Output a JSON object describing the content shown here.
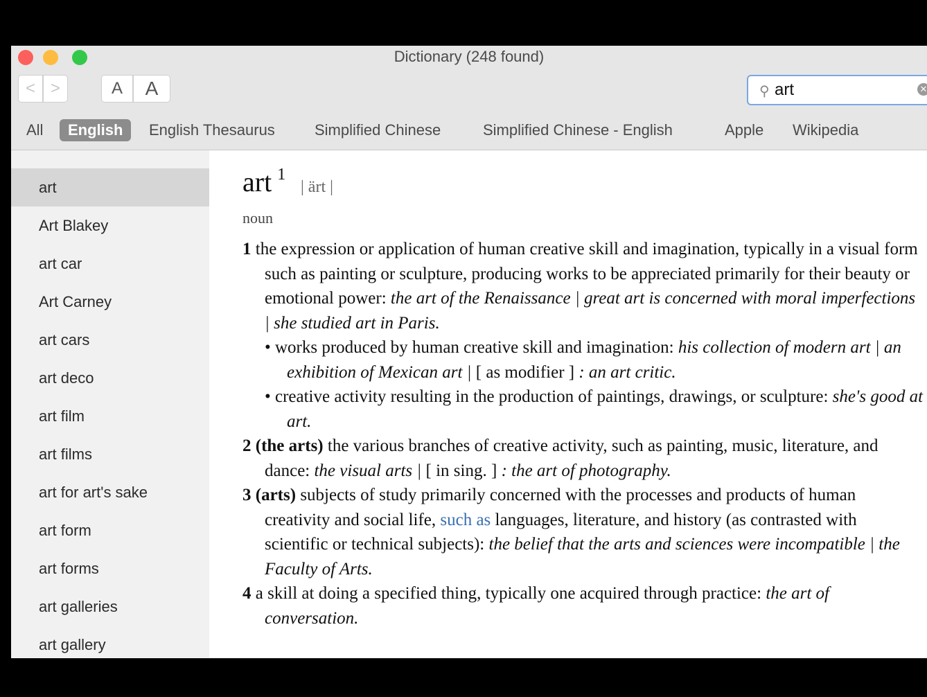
{
  "window": {
    "title": "Dictionary (248 found)"
  },
  "toolbar": {
    "back_label": "<",
    "forward_label": ">",
    "font_smaller_label": "A",
    "font_larger_label": "A"
  },
  "search": {
    "value": "art"
  },
  "tabs": [
    "All",
    "English",
    "English Thesaurus",
    "Simplified Chinese",
    "Simplified Chinese - English",
    "Apple",
    "Wikipedia"
  ],
  "active_tab": "English",
  "sidebar": {
    "items": [
      "art",
      "Art Blakey",
      "art car",
      "Art Carney",
      "art cars",
      "art deco",
      "art film",
      "art films",
      "art for art's sake",
      "art form",
      "art forms",
      "art galleries",
      "art gallery"
    ],
    "selected": "art"
  },
  "entry": {
    "headword": "art",
    "homograph": "1",
    "pronunciation": "| ärt |",
    "part_of_speech": "noun",
    "senses": [
      {
        "number": "1",
        "text": "the expression or application of human creative skill and imagination, typically in a visual form such as painting or sculpture, producing works to be appreciated primarily for their beauty or emotional power:",
        "example": "the art of the Renaissance | great art is concerned with moral imperfections | she studied art in Paris.",
        "subsenses": [
          {
            "text": "• works produced by human creative skill and imagination:",
            "example": "his collection of modern art | an exhibition of Mexican art |",
            "note": "[ as modifier ]",
            "example2": ": an art critic."
          },
          {
            "text": "• creative activity resulting in the production of paintings, drawings, or sculpture:",
            "example": "she's good at art."
          }
        ]
      },
      {
        "number": "2",
        "label": "(the arts)",
        "text": "the various branches of creative activity, such as painting, music, literature, and dance:",
        "example": "the visual arts |",
        "note": "[ in sing. ]",
        "example2": ": the art of photography."
      },
      {
        "number": "3",
        "label": "(arts)",
        "text_before": "subjects of study primarily concerned with the processes and products of human creativity and social life,",
        "link": "such as",
        "text_after": "languages, literature, and history (as contrasted with scientific or technical subjects):",
        "example": "the belief that the arts and sciences were incompatible | the Faculty of Arts."
      },
      {
        "number": "4",
        "text": "a skill at doing a specified thing, typically one acquired through practice:",
        "example": "the art of conversation."
      }
    ]
  }
}
